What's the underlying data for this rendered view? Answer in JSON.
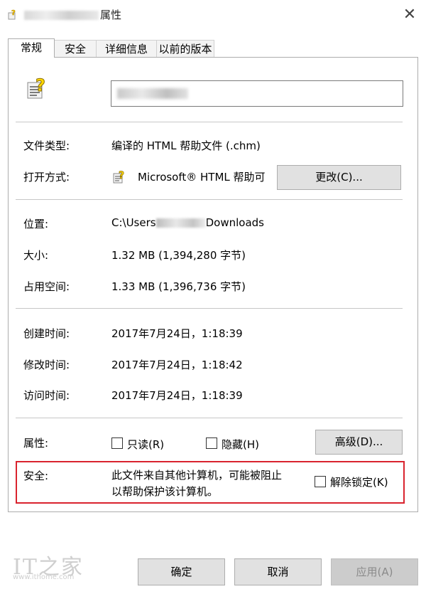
{
  "window": {
    "title_suffix": "属性",
    "close_glyph": "✕"
  },
  "tabs": [
    {
      "label": "常规",
      "active": true
    },
    {
      "label": "安全"
    },
    {
      "label": "详细信息"
    },
    {
      "label": "以前的版本"
    }
  ],
  "general": {
    "rows1": [
      {
        "label": "文件类型:",
        "value": "编译的 HTML 帮助文件 (.chm)"
      },
      {
        "label": "打开方式:",
        "value": "Microsoft® HTML 帮助可"
      }
    ],
    "change_button": "更改(C)...",
    "location": {
      "label": "位置:",
      "prefix": "C:\\Users",
      "suffix": "Downloads"
    },
    "size": {
      "label": "大小:",
      "value": "1.32 MB (1,394,280 字节)"
    },
    "disk_size": {
      "label": "占用空间:",
      "value": "1.33 MB (1,396,736 字节)"
    },
    "created": {
      "label": "创建时间:",
      "value": "2017年7月24日，1:18:39"
    },
    "modified": {
      "label": "修改时间:",
      "value": "2017年7月24日，1:18:42"
    },
    "accessed": {
      "label": "访问时间:",
      "value": "2017年7月24日，1:18:39"
    },
    "attributes": {
      "label": "属性:",
      "readonly": "只读(R)",
      "hidden": "隐藏(H)",
      "advanced_button": "高级(D)..."
    },
    "security": {
      "label": "安全:",
      "line1": "此文件来自其他计算机，可能被阻止",
      "line2": "以帮助保护该计算机。",
      "unblock": "解除锁定(K)",
      "highlight_color": "#d9232e"
    }
  },
  "buttons": {
    "ok": "确定",
    "cancel": "取消",
    "apply": "应用(A)"
  },
  "watermark": {
    "logo": "IT之家",
    "url": "www.ithome.com"
  }
}
